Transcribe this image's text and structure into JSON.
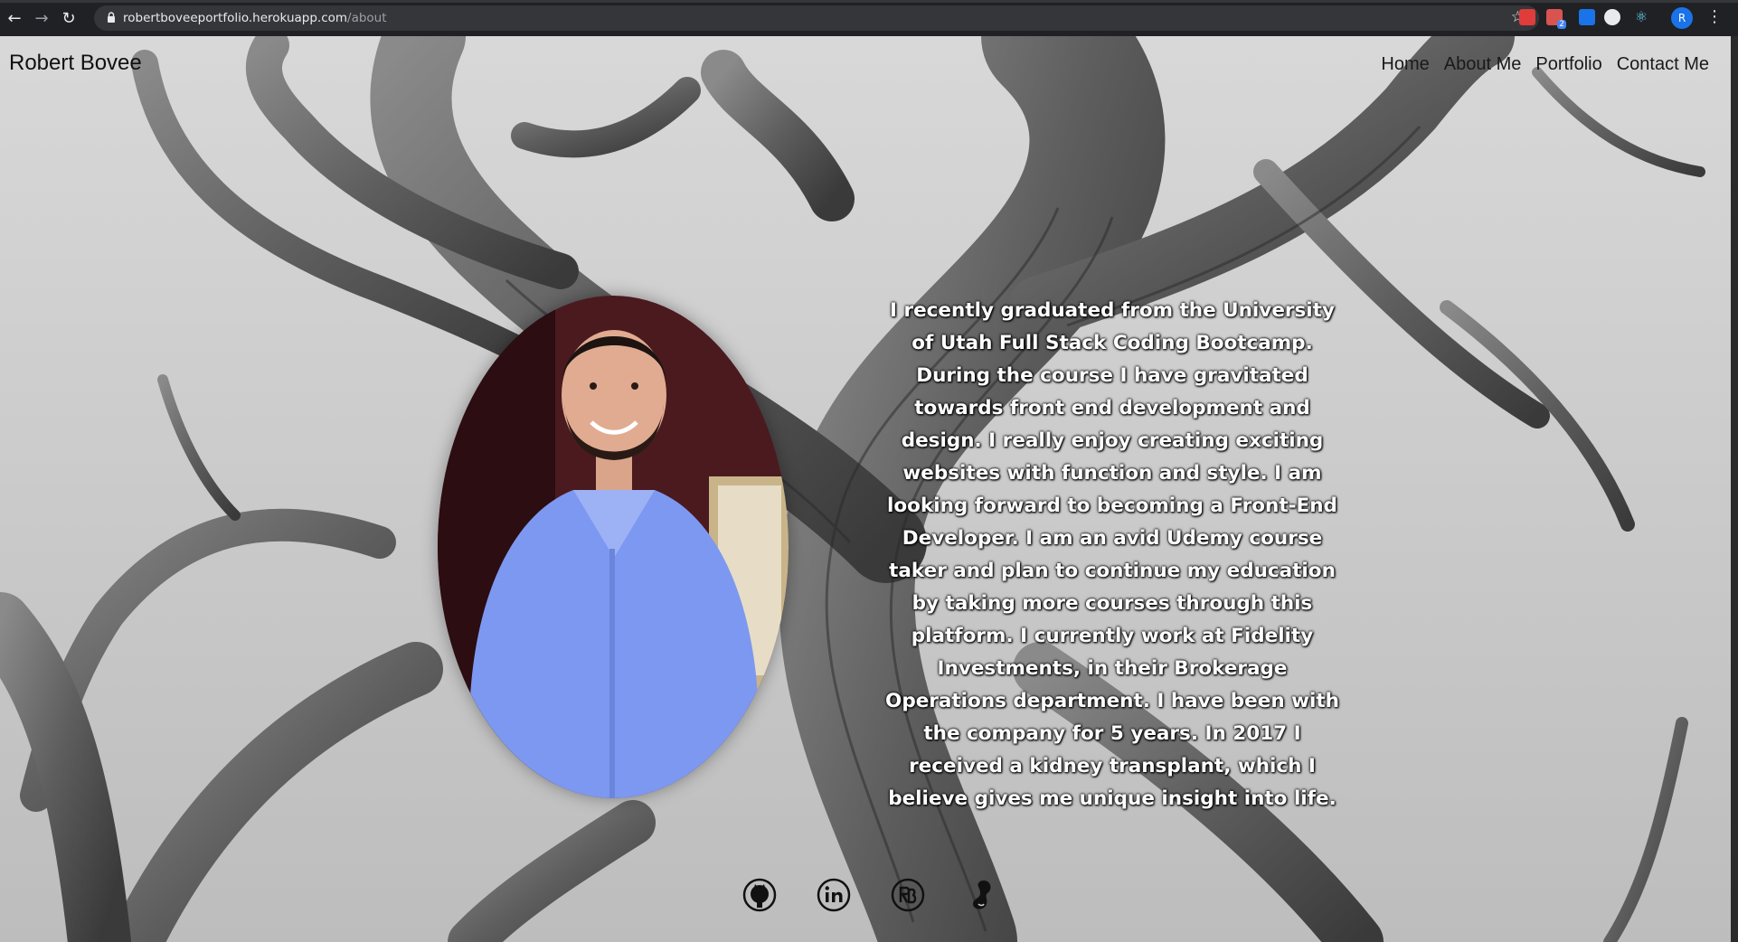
{
  "browser": {
    "url_host": "robertboveeportfolio.herokuapp.com",
    "url_path": "/about",
    "profile_initial": "R",
    "extension_badge": "2"
  },
  "site": {
    "brand": "Robert Bovee",
    "nav": {
      "home": "Home",
      "about": "About Me",
      "portfolio": "Portfolio",
      "contact": "Contact Me"
    }
  },
  "about": {
    "bio": "I recently graduated from the University of Utah Full Stack Coding Bootcamp. During the course I have gravitated towards front end development and design. I really enjoy creating exciting websites with function and style. I am looking forward to becoming a Front-End Developer. I am an avid Udemy course taker and plan to continue my education by taking more courses through this platform. I currently work at Fidelity Investments, in their Brokerage Operations department. I have been with the company for 5 years. In 2017 I received a kidney transplant, which I believe gives me unique insight into life."
  },
  "socials": [
    {
      "icon": "github-icon"
    },
    {
      "icon": "linkedin-icon"
    },
    {
      "icon": "rb-logo-icon"
    },
    {
      "icon": "kidney-icon"
    }
  ],
  "colors": {
    "chrome_bg": "#202124",
    "omnibox_bg": "#35363a",
    "shirt_blue": "#7d98f0",
    "bio_text": "#ffffff"
  }
}
